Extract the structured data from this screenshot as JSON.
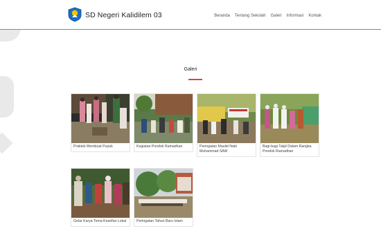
{
  "site": {
    "brand": "SD Negeri Kalidilem 03"
  },
  "nav": {
    "items": [
      "Beranda",
      "Tentang Sekolah",
      "Galeri",
      "Informasi",
      "Kontak"
    ]
  },
  "gallery": {
    "title": "Galeri",
    "items": [
      "Praktek Membuat Pupuk",
      "Kegiatan Pondok Ramadhan",
      "Peringatan Maulid Nabi Muhammad SAW",
      "Bagi-bagi Takjil Dalam Rangka Pondok Ramadhan",
      "Gelar Karya Tema Kearifan Lokal",
      "Peringatan Tahun Baru Islam"
    ]
  },
  "colors": {
    "accent_red": "#d9443a",
    "navbar_border": "#6a8fb0"
  }
}
